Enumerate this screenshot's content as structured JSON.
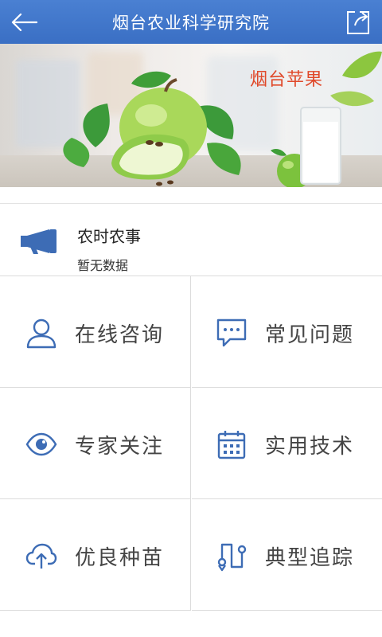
{
  "header": {
    "title": "烟台农业科学研究院",
    "back_icon": "arrow-left-icon",
    "share_icon": "share-icon"
  },
  "banner": {
    "title": "烟台苹果"
  },
  "news": {
    "title": "农时农事",
    "subtitle": "暂无数据",
    "icon": "megaphone-icon"
  },
  "grid": {
    "items": [
      {
        "label": "在线咨询",
        "icon": "user-icon"
      },
      {
        "label": "常见问题",
        "icon": "chat-bubble-icon"
      },
      {
        "label": "专家关注",
        "icon": "eye-icon"
      },
      {
        "label": "实用技术",
        "icon": "calendar-icon"
      },
      {
        "label": "优良种苗",
        "icon": "cloud-upload-icon"
      },
      {
        "label": "典型追踪",
        "icon": "route-icon"
      }
    ]
  },
  "colors": {
    "header": "#3f76c8",
    "icon": "#3d6cb5",
    "banner_title": "#e0492a"
  }
}
